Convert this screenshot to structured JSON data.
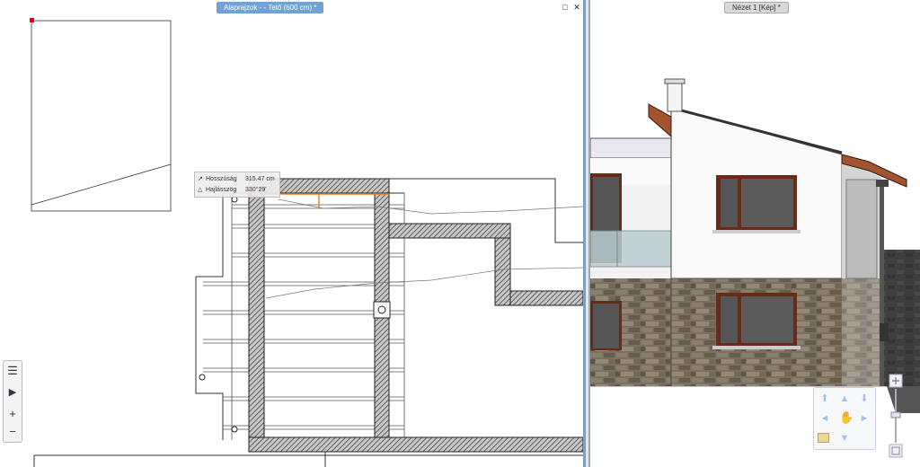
{
  "left_window": {
    "tab_title": "Alaprajzok -  - Tető (600 cm) *",
    "buttons": {
      "maximize": "□",
      "close": "✕"
    }
  },
  "right_window": {
    "tab_title": "Nézet 1 [Kép] *"
  },
  "measure_tooltip": {
    "length_icon": "↗",
    "length_label": "Hosszúság",
    "length_value": "315.47 cm",
    "angle_icon": "△",
    "angle_label": "Hajlásszög",
    "angle_value": "330°29'"
  },
  "side_toolbar": {
    "items": [
      {
        "icon": "list-icon",
        "glyph": "☰"
      },
      {
        "icon": "play-icon",
        "glyph": "▶"
      },
      {
        "icon": "plus-icon",
        "glyph": "+"
      },
      {
        "icon": "minus-icon",
        "glyph": "−"
      }
    ]
  },
  "nav_pad": {
    "icons": [
      "up-left-arrow-icon",
      "up-arrow-icon",
      "down-arrow-icon",
      "left-arrow-icon",
      "pan-hand-icon",
      "right-arrow-icon",
      "down-arrow-icon",
      "layer-icon"
    ]
  },
  "colors": {
    "active_tab": "#6fa3d6",
    "inactive_tab": "#d9d9d9",
    "stone": "#6e6558",
    "roof": "#a4532f",
    "glass": "#b9cccf"
  }
}
